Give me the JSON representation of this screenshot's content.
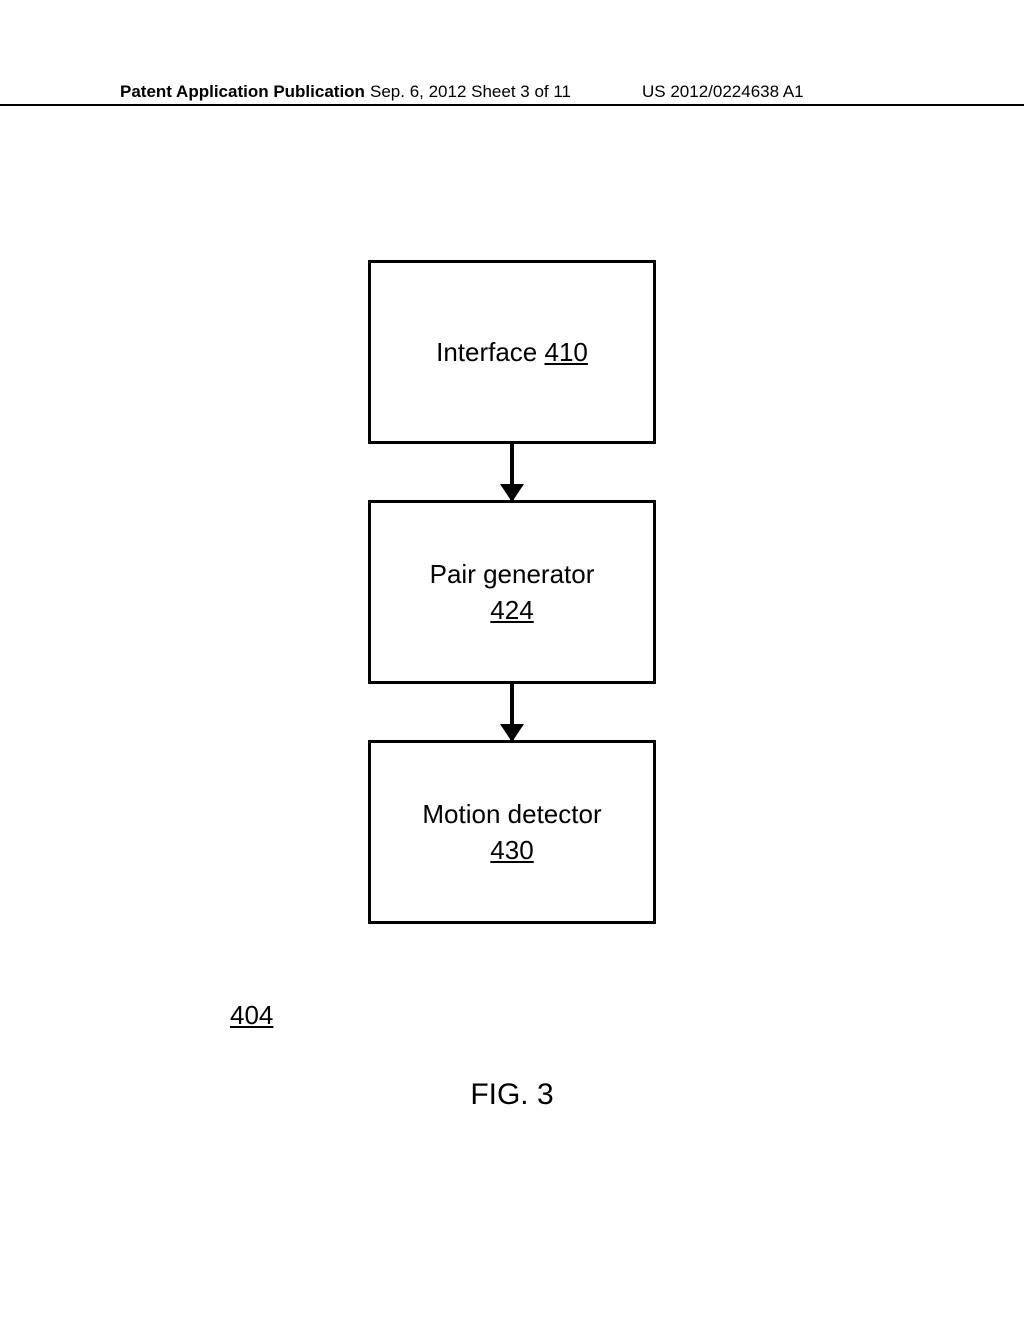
{
  "header": {
    "left": "Patent Application Publication",
    "center": "Sep. 6, 2012  Sheet 3 of 11",
    "right": "US 2012/0224638 A1"
  },
  "diagram": {
    "boxes": [
      {
        "label": "Interface ",
        "ref": "410"
      },
      {
        "label": "Pair generator",
        "ref": "424"
      },
      {
        "label": "Motion detector",
        "ref": "430"
      }
    ],
    "figure_ref": "404",
    "caption": "FIG. 3"
  }
}
